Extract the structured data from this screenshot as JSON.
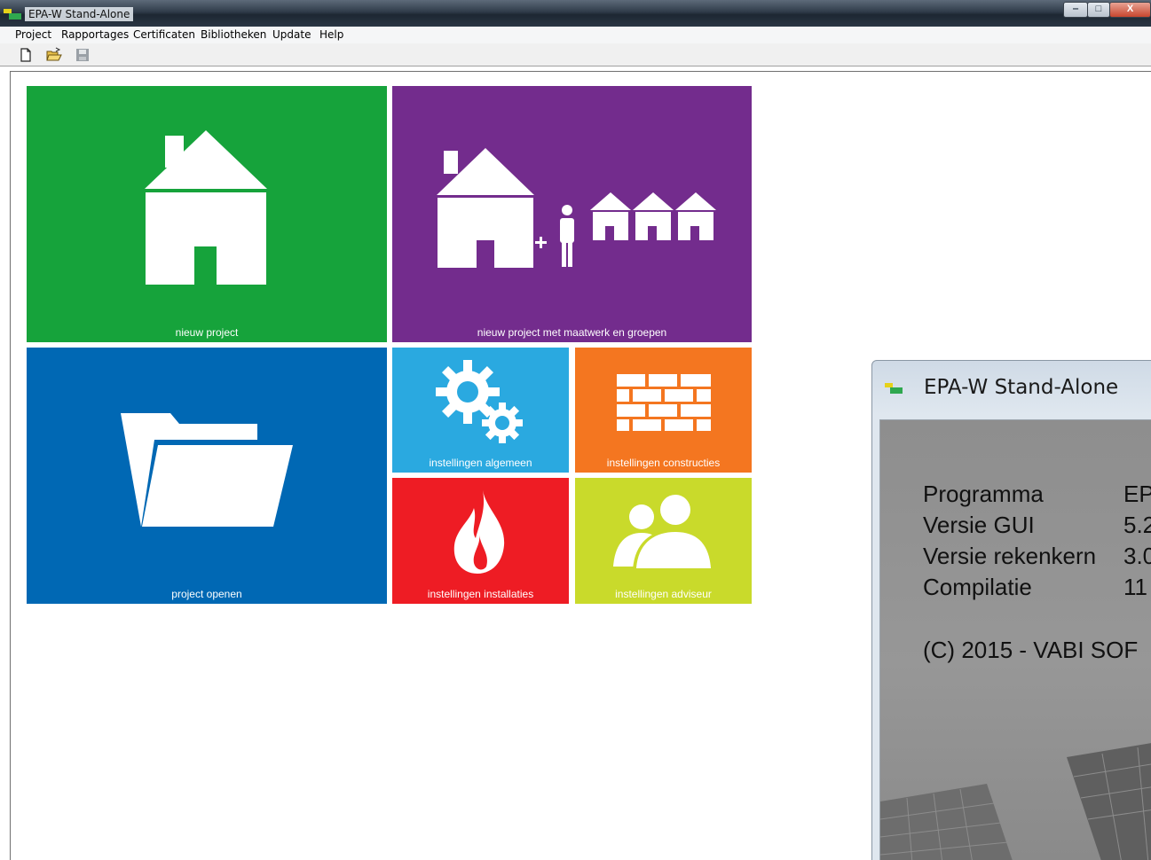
{
  "window": {
    "title": "EPA-W Stand-Alone",
    "controls": {
      "minimize": "‒",
      "maximize": "□",
      "close": "X"
    }
  },
  "menu": {
    "items": [
      "Project",
      "Rapportages",
      "Certificaten",
      "Bibliotheken",
      "Update",
      "Help"
    ]
  },
  "toolbar": {
    "buttons": [
      {
        "icon": "new-document-icon"
      },
      {
        "icon": "open-folder-icon"
      },
      {
        "icon": "save-disk-icon"
      }
    ]
  },
  "tiles": [
    {
      "label": "nieuw project",
      "color": "#16a33b",
      "icon": "house-icon"
    },
    {
      "label": "nieuw project met maatwerk en groepen",
      "color": "#732c8d",
      "icon": "house-person-houses-icon"
    },
    {
      "label": "project openen",
      "color": "#0068b4",
      "icon": "folder-icon"
    },
    {
      "label": "instellingen algemeen",
      "color": "#2aa9e0",
      "icon": "gears-icon"
    },
    {
      "label": "instellingen constructies",
      "color": "#f47620",
      "icon": "brick-wall-icon"
    },
    {
      "label": "instellingen installaties",
      "color": "#ee1c24",
      "icon": "flame-icon"
    },
    {
      "label": "instellingen adviseur",
      "color": "#c9da2b",
      "icon": "users-icon"
    }
  ],
  "about_dialog": {
    "title": "EPA-W Stand-Alone",
    "rows": [
      {
        "key": "Programma",
        "value": "EP"
      },
      {
        "key": "Versie GUI",
        "value": "5.2"
      },
      {
        "key": "Versie rekenkern",
        "value": "3.0"
      },
      {
        "key": "Compilatie",
        "value": "11"
      }
    ],
    "copyright": "(C) 2015 - VABI SOF"
  }
}
